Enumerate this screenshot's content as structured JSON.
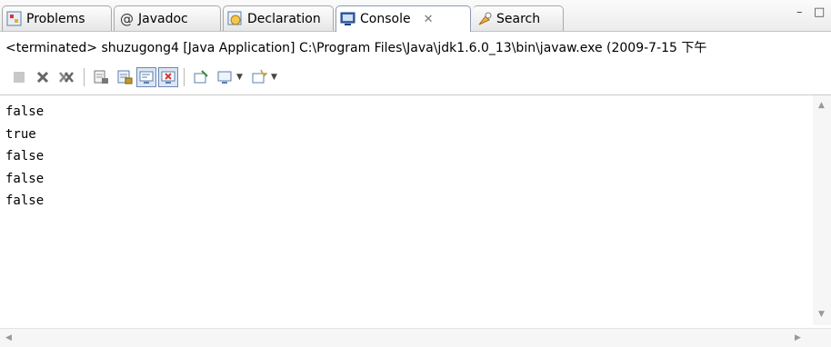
{
  "tabs": [
    {
      "label": "Problems",
      "icon": "problems-icon"
    },
    {
      "label": "Javadoc",
      "icon": "at-icon"
    },
    {
      "label": "Declaration",
      "icon": "declaration-icon"
    },
    {
      "label": "Console",
      "icon": "console-icon",
      "active": true
    },
    {
      "label": "Search",
      "icon": "search-icon"
    }
  ],
  "view_controls": {
    "minimize": "–",
    "maximize": "□",
    "close": "✕"
  },
  "status_line": "<terminated> shuzugong4 [Java Application] C:\\Program Files\\Java\\jdk1.6.0_13\\bin\\javaw.exe (2009-7-15 下午",
  "console_lines": [
    "false",
    "true",
    "false",
    "false",
    "false"
  ],
  "colors": {
    "tab_border": "#8a9bb3",
    "background": "#ffffff",
    "pressed": "#dce6f4"
  }
}
